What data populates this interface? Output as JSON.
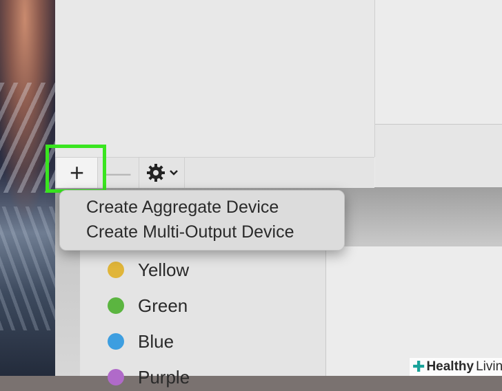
{
  "toolbar": {
    "add_label": "+",
    "remove_label": "—",
    "gear_icon": "gear-icon",
    "chevron": "⌄"
  },
  "menu": {
    "items": [
      "Create Aggregate Device",
      "Create Multi-Output Device"
    ]
  },
  "tags": {
    "items": [
      {
        "label": "Yellow",
        "color": "#e0b53a"
      },
      {
        "label": "Green",
        "color": "#5bb540"
      },
      {
        "label": "Blue",
        "color": "#3d9ee0"
      },
      {
        "label": "Purple",
        "color": "#b06ac9"
      }
    ]
  },
  "watermark": {
    "brand_bold": "Healthy",
    "brand_rest": "Living"
  },
  "colors": {
    "highlight": "#39e51f",
    "watermark_cross": "#1aa39a"
  }
}
